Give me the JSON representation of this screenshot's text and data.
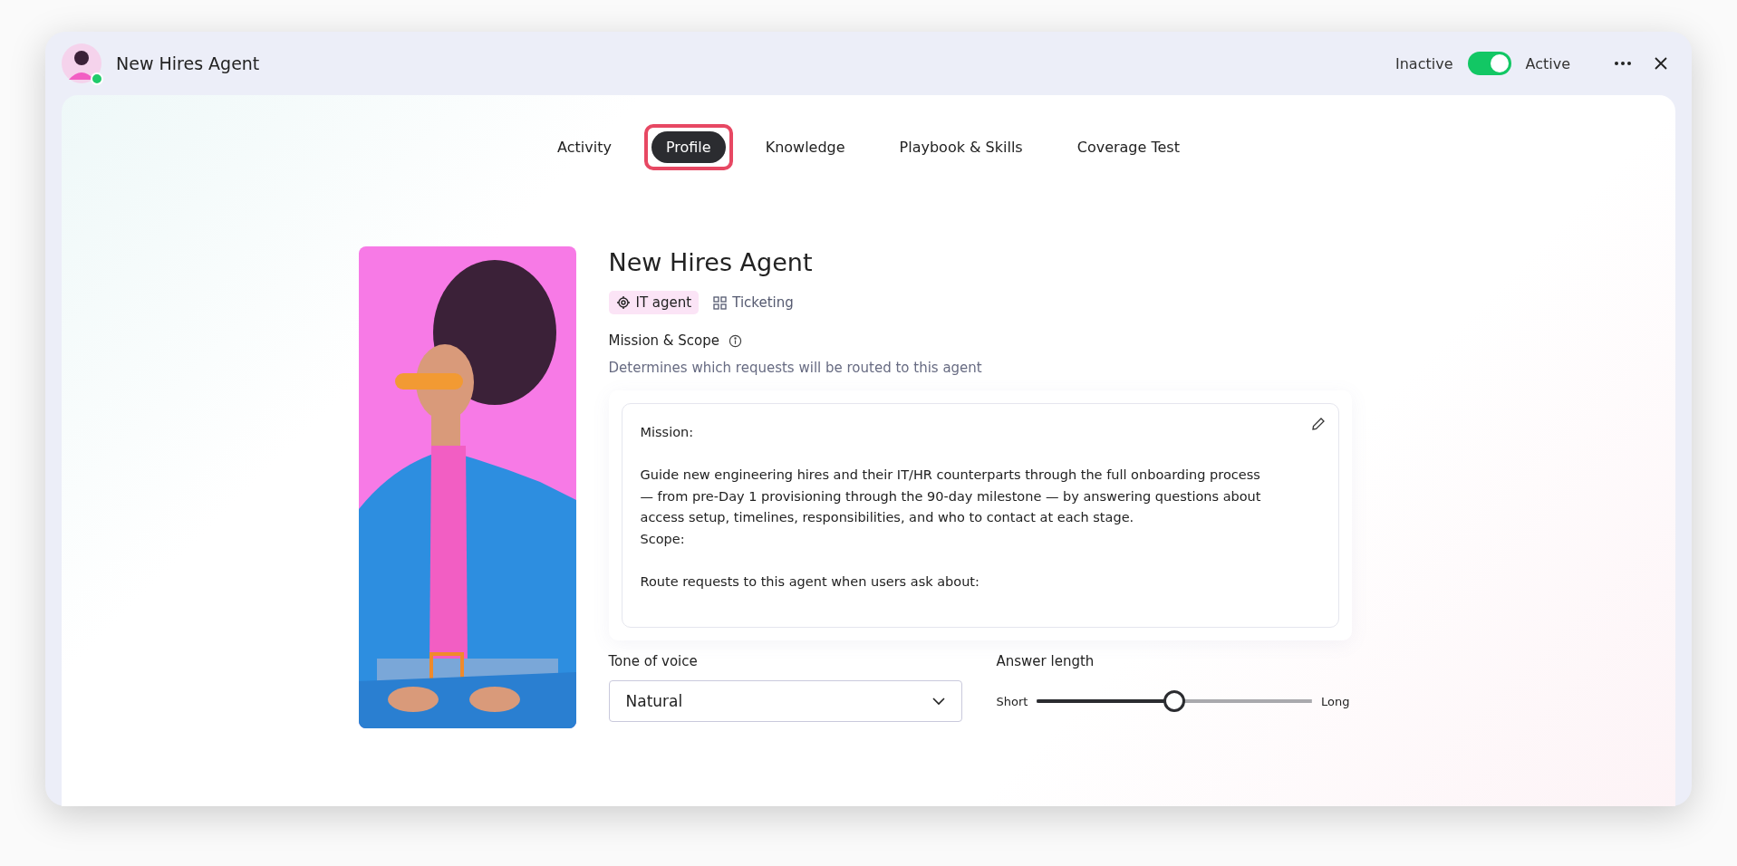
{
  "header": {
    "title": "New Hires Agent",
    "online": true,
    "status_off_label": "Inactive",
    "status_on_label": "Active",
    "status_on": true
  },
  "tabs": [
    {
      "label": "Activity",
      "selected": false,
      "annotated": false
    },
    {
      "label": "Profile",
      "selected": true,
      "annotated": true
    },
    {
      "label": "Knowledge",
      "selected": false,
      "annotated": false
    },
    {
      "label": "Playbook & Skills",
      "selected": false,
      "annotated": false
    },
    {
      "label": "Coverage Test",
      "selected": false,
      "annotated": false
    }
  ],
  "profile": {
    "name": "New Hires Agent",
    "tags": [
      {
        "kind": "target",
        "label": "IT agent",
        "selected": true
      },
      {
        "kind": "grid",
        "label": "Ticketing",
        "selected": false
      }
    ],
    "mission_label": "Mission & Scope",
    "mission_hint": "Determines which requests will be routed to this agent",
    "mission_text": "Mission:\n\nGuide new engineering hires and their IT/HR counterparts through the full onboarding process — from pre-Day 1 provisioning through the 90-day milestone — by answering questions about access setup, timelines, responsibilities, and who to contact at each stage.\nScope:\n\nRoute requests to this agent when users ask about:",
    "tone_label": "Tone of voice",
    "tone_value": "Natural",
    "length_label": "Answer length",
    "length_min": "Short",
    "length_max": "Long",
    "length_slider": {
      "level": 0.5
    }
  }
}
